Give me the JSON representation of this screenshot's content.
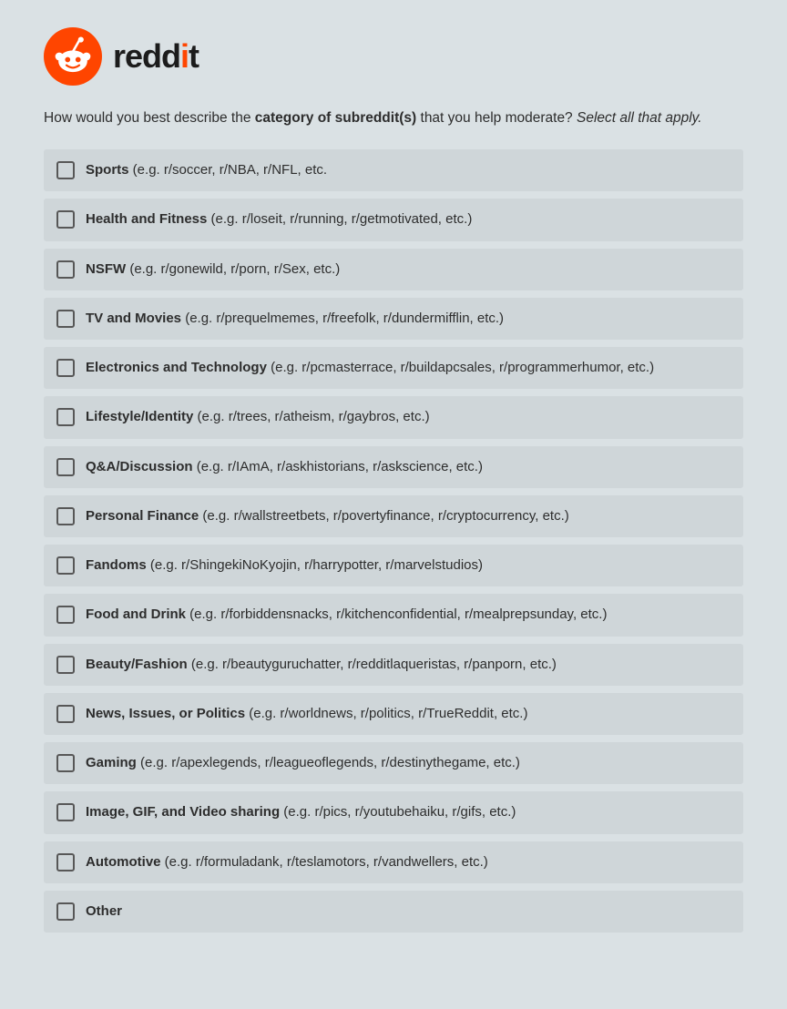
{
  "logo": {
    "wordmark_pre": "redd",
    "wordmark_dot": "i",
    "wordmark_post": "t"
  },
  "question": {
    "pre": "How would you best describe the ",
    "bold": "category of subreddit(s)",
    "mid": " that you help moderate? ",
    "ital": "Select all that apply.",
    "post": ""
  },
  "options": [
    {
      "title": "Sports",
      "ex": " (e.g. r/soccer, r/NBA, r/NFL, etc."
    },
    {
      "title": "Health and Fitness",
      "ex": " (e.g. r/loseit, r/running, r/getmotivated, etc.)"
    },
    {
      "title": "NSFW",
      "ex": " (e.g. r/gonewild, r/porn, r/Sex, etc.)"
    },
    {
      "title": "TV and Movies",
      "ex": " (e.g. r/prequelmemes, r/freefolk, r/dundermifflin, etc.)"
    },
    {
      "title": "Electronics and Technology",
      "ex": " (e.g. r/pcmasterrace, r/buildapcsales, r/programmerhumor, etc.)"
    },
    {
      "title": "Lifestyle/Identity",
      "ex": " (e.g. r/trees, r/atheism, r/gaybros, etc.)"
    },
    {
      "title": "Q&A/Discussion",
      "ex": " (e.g. r/IAmA, r/askhistorians, r/askscience, etc.)"
    },
    {
      "title": "Personal Finance",
      "ex": " (e.g. r/wallstreetbets, r/povertyfinance, r/cryptocurrency, etc.)"
    },
    {
      "title": "Fandoms",
      "ex": " (e.g. r/ShingekiNoKyojin, r/harrypotter, r/marvelstudios)"
    },
    {
      "title": "Food and Drink",
      "ex": " (e.g. r/forbiddensnacks, r/kitchenconfidential, r/mealprepsunday, etc.)"
    },
    {
      "title": "Beauty/Fashion",
      "ex": " (e.g. r/beautyguruchatter, r/redditlaqueristas, r/panporn, etc.)"
    },
    {
      "title": "News, Issues, or Politics",
      "ex": " (e.g. r/worldnews, r/politics, r/TrueReddit, etc.)"
    },
    {
      "title": "Gaming",
      "ex": " (e.g. r/apexlegends, r/leagueoflegends, r/destinythegame, etc.)"
    },
    {
      "title": "Image, GIF, and Video sharing",
      "ex": " (e.g. r/pics, r/youtubehaiku, r/gifs, etc.)"
    },
    {
      "title": "Automotive",
      "ex": " (e.g. r/formuladank, r/teslamotors, r/vandwellers, etc.)"
    },
    {
      "title": "Other",
      "ex": ""
    }
  ]
}
